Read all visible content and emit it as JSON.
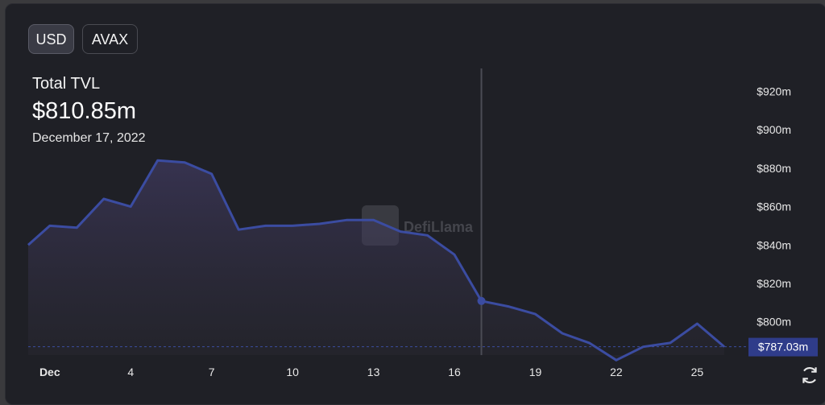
{
  "toggles": {
    "usd": "USD",
    "avax": "AVAX"
  },
  "header": {
    "title": "Total TVL",
    "value": "$810.85m",
    "date": "December 17, 2022"
  },
  "watermark": "DefiLlama",
  "colors": {
    "line": "#3b4ca1",
    "background": "#1f2026",
    "current_badge": "#2f3c8a",
    "crosshair": "#4b4c55"
  },
  "chart_data": {
    "type": "area",
    "x": [
      1,
      2,
      3,
      4,
      5,
      6,
      7,
      8,
      9,
      10,
      11,
      12,
      13,
      14,
      15,
      16,
      17,
      18,
      19,
      20,
      21,
      22,
      23,
      24,
      25,
      26
    ],
    "x_day_label": "Dec",
    "xtick_labels": [
      "Dec",
      "4",
      "7",
      "10",
      "13",
      "16",
      "19",
      "22",
      "25"
    ],
    "y": [
      840,
      850,
      849,
      864,
      860,
      884,
      883,
      877,
      848,
      850,
      850,
      851,
      853,
      853,
      847,
      845,
      835,
      810.85,
      808,
      804,
      794,
      789,
      780,
      787,
      789,
      799,
      787.03
    ],
    "ytick_labels": [
      "$800m",
      "$820m",
      "$840m",
      "$860m",
      "$880m",
      "$900m",
      "$920m"
    ],
    "ylim": [
      775,
      925
    ],
    "hovered": {
      "x": 17,
      "value": "$810.85m"
    },
    "current_label": "$787.03m",
    "grid": false
  }
}
